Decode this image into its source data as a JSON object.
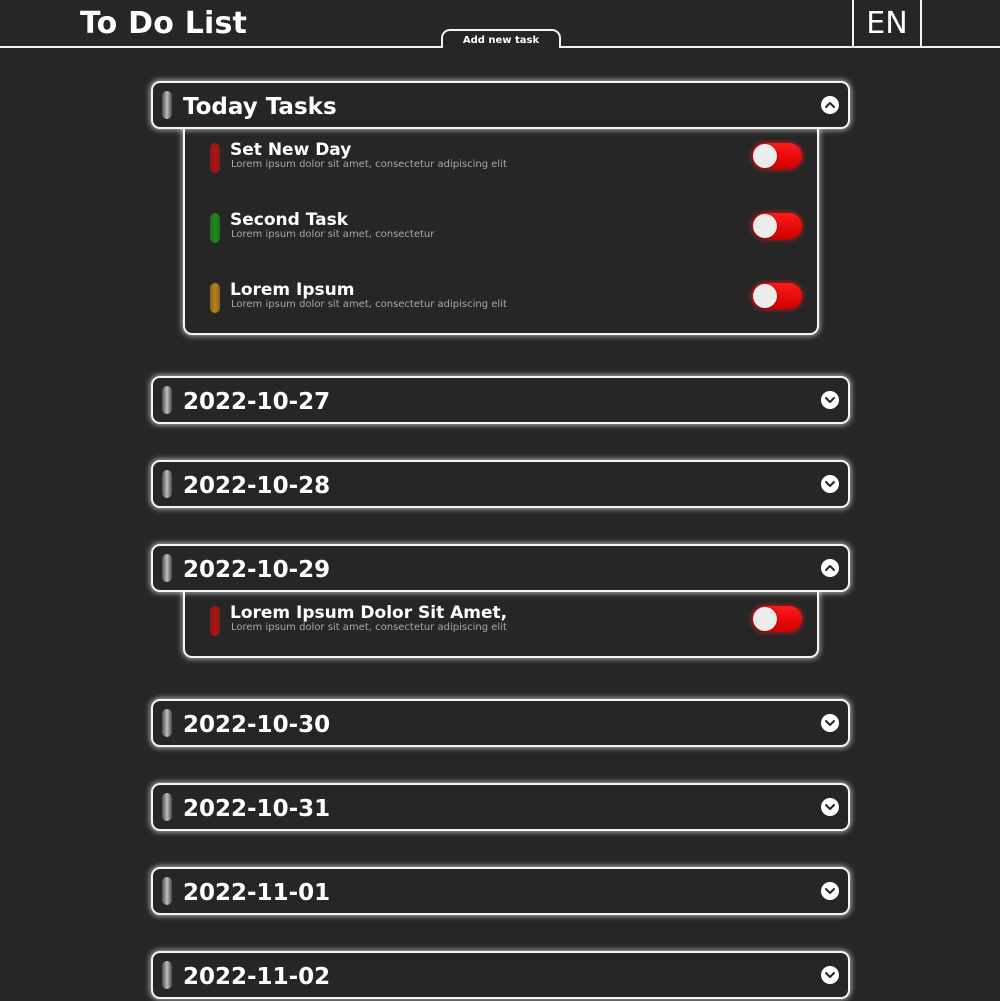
{
  "header": {
    "title": "To Do List",
    "add_task_label": "Add new task",
    "language": "EN"
  },
  "sections": [
    {
      "title": "Today Tasks",
      "expanded": true,
      "tasks": [
        {
          "title": "Set New Day",
          "description": "Lorem ipsum dolor sit amet, consectetur adipiscing elit",
          "color": "#b01414",
          "done": false
        },
        {
          "title": "Second Task",
          "description": "Lorem ipsum dolor sit amet, consectetur",
          "color": "#1e8a1e",
          "done": false
        },
        {
          "title": "Lorem Ipsum",
          "description": "Lorem ipsum dolor sit amet, consectetur adipiscing elit",
          "color": "#b8821c",
          "done": false
        }
      ]
    },
    {
      "title": "2022-10-27",
      "expanded": false,
      "tasks": []
    },
    {
      "title": "2022-10-28",
      "expanded": false,
      "tasks": []
    },
    {
      "title": "2022-10-29",
      "expanded": true,
      "tasks": [
        {
          "title": "Lorem Ipsum Dolor Sit Amet,",
          "description": "Lorem ipsum dolor sit amet, consectetur adipiscing elit",
          "color": "#b01414",
          "done": false
        }
      ]
    },
    {
      "title": "2022-10-30",
      "expanded": false,
      "tasks": []
    },
    {
      "title": "2022-10-31",
      "expanded": false,
      "tasks": []
    },
    {
      "title": "2022-11-01",
      "expanded": false,
      "tasks": []
    },
    {
      "title": "2022-11-02",
      "expanded": false,
      "tasks": []
    }
  ],
  "icons": {
    "section_grip": "grip-handle-icon",
    "expanded": "chevron-up-icon",
    "collapsed": "chevron-down-icon"
  },
  "colors": {
    "background": "#262626",
    "border": "#f5f5f5",
    "toggle_off": "#e00000",
    "description_text": "#a8a8a8"
  }
}
